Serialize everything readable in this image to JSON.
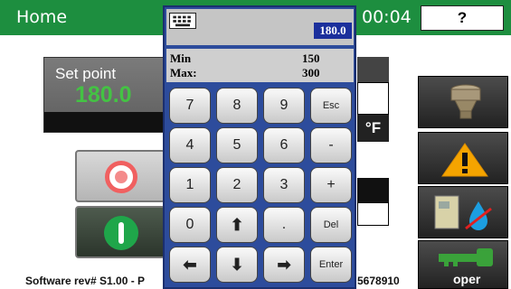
{
  "header": {
    "title": "Home",
    "time": "00:04",
    "help_label": "?"
  },
  "setpoint": {
    "label": "Set point",
    "value": "180.0"
  },
  "unit": "°F",
  "right_buttons": {
    "oper_label": "oper"
  },
  "footer": {
    "left_text": "Software rev# S1.00 - P",
    "right_text": "5678910"
  },
  "keypad": {
    "entry_value": "180.0",
    "min_label": "Min",
    "min_value": "150",
    "max_label": "Max:",
    "max_value": "300",
    "rows": [
      [
        "7",
        "8",
        "9",
        "Esc"
      ],
      [
        "4",
        "5",
        "6",
        "-"
      ],
      [
        "1",
        "2",
        "3",
        "+"
      ],
      [
        "0",
        "⬆",
        ".",
        "Del"
      ],
      [
        "⬅",
        "⬇",
        "➡",
        "Enter"
      ]
    ]
  },
  "colors": {
    "header_green": "#1d8e3f",
    "setpoint_green": "#44c244",
    "keypad_blue": "#2d4c9c"
  }
}
